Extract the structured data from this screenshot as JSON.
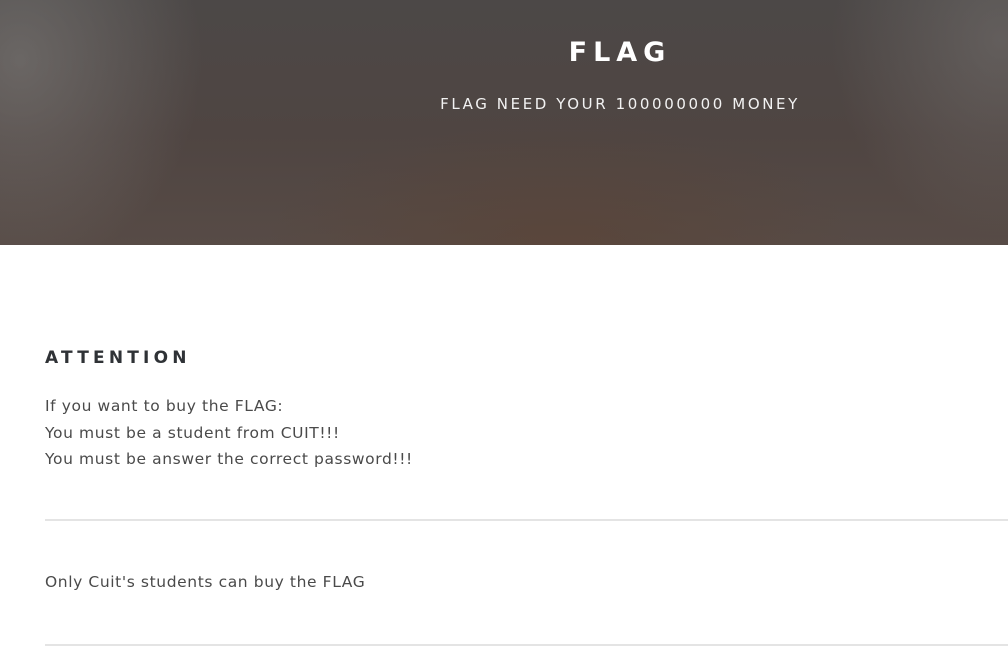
{
  "header": {
    "title": "FLAG",
    "subtitle": "FLAG NEED YOUR 100000000 MONEY"
  },
  "main": {
    "heading": "ATTENTION",
    "lines": [
      "If you want to buy the FLAG:",
      "You must be a student from CUIT!!!",
      "You must be answer the correct password!!!"
    ],
    "note": "Only Cuit's students can buy the FLAG"
  }
}
